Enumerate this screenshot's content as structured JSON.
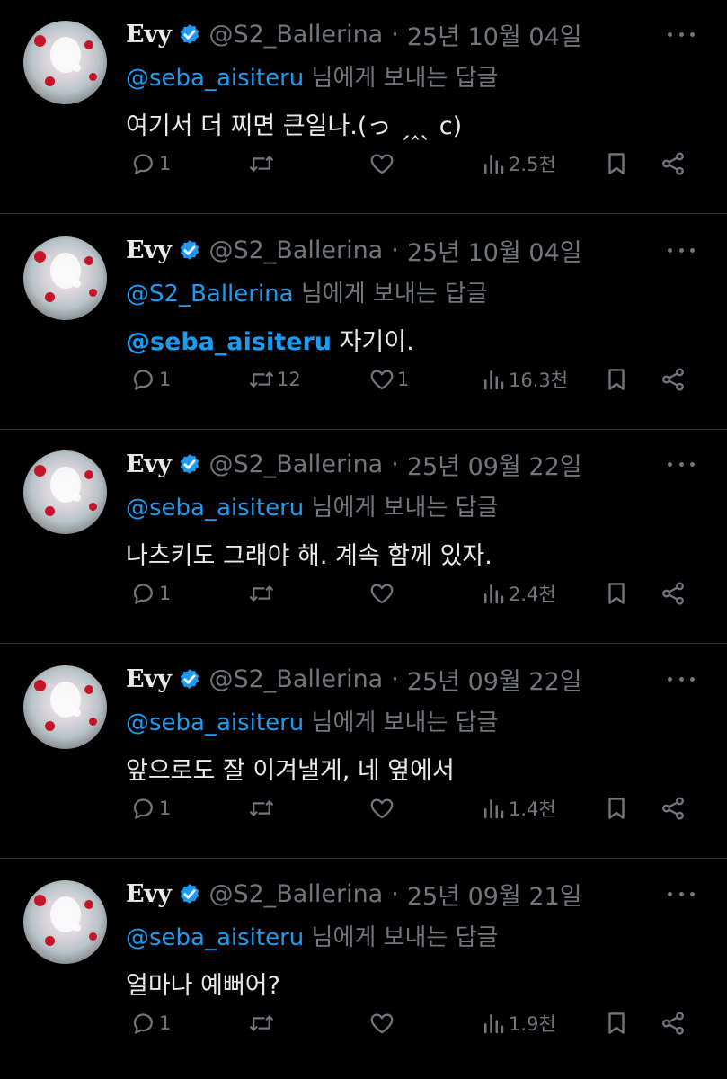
{
  "tweets": [
    {
      "name": "Evy",
      "handle": "@S2_Ballerina",
      "separator": "·",
      "date": "25년 10월 04일",
      "reply_to": "@seba_aisiteru",
      "reply_suffix": "님에게 보내는 답글",
      "text_mention": "",
      "text": "여기서 더 찌면 큰일나.(っ ˏ‸ˎ c)",
      "replies": "1",
      "retweets": "",
      "likes": "",
      "views": "2.5천"
    },
    {
      "name": "Evy",
      "handle": "@S2_Ballerina",
      "separator": "·",
      "date": "25년 10월 04일",
      "reply_to": "@S2_Ballerina",
      "reply_suffix": "님에게 보내는 답글",
      "text_mention": "@seba_aisiteru",
      "text": " 자기이.",
      "replies": "1",
      "retweets": "12",
      "likes": "1",
      "views": "16.3천"
    },
    {
      "name": "Evy",
      "handle": "@S2_Ballerina",
      "separator": "·",
      "date": "25년 09월 22일",
      "reply_to": "@seba_aisiteru",
      "reply_suffix": "님에게 보내는 답글",
      "text_mention": "",
      "text": "나츠키도 그래야 해. 계속 함께 있자.",
      "replies": "1",
      "retweets": "",
      "likes": "",
      "views": "2.4천"
    },
    {
      "name": "Evy",
      "handle": "@S2_Ballerina",
      "separator": "·",
      "date": "25년 09월 22일",
      "reply_to": "@seba_aisiteru",
      "reply_suffix": "님에게 보내는 답글",
      "text_mention": "",
      "text": "앞으로도 잘 이겨낼게, 네 옆에서",
      "replies": "1",
      "retweets": "",
      "likes": "",
      "views": "1.4천"
    },
    {
      "name": "Evy",
      "handle": "@S2_Ballerina",
      "separator": "·",
      "date": "25년 09월 21일",
      "reply_to": "@seba_aisiteru",
      "reply_suffix": "님에게 보내는 답글",
      "text_mention": "",
      "text": "얼마나 예뻐어?",
      "replies": "1",
      "retweets": "",
      "likes": "",
      "views": "1.9천"
    }
  ],
  "icons": {
    "reply": "reply-icon",
    "retweet": "retweet-icon",
    "like": "heart-icon",
    "views": "views-icon",
    "bookmark": "bookmark-icon",
    "share": "share-icon",
    "verified": "verified-badge-icon",
    "more": "more-icon"
  },
  "colors": {
    "background": "#000000",
    "text": "#e7e9ea",
    "secondary": "#71767b",
    "accent": "#1d9bf0",
    "divider": "#2f3336"
  }
}
